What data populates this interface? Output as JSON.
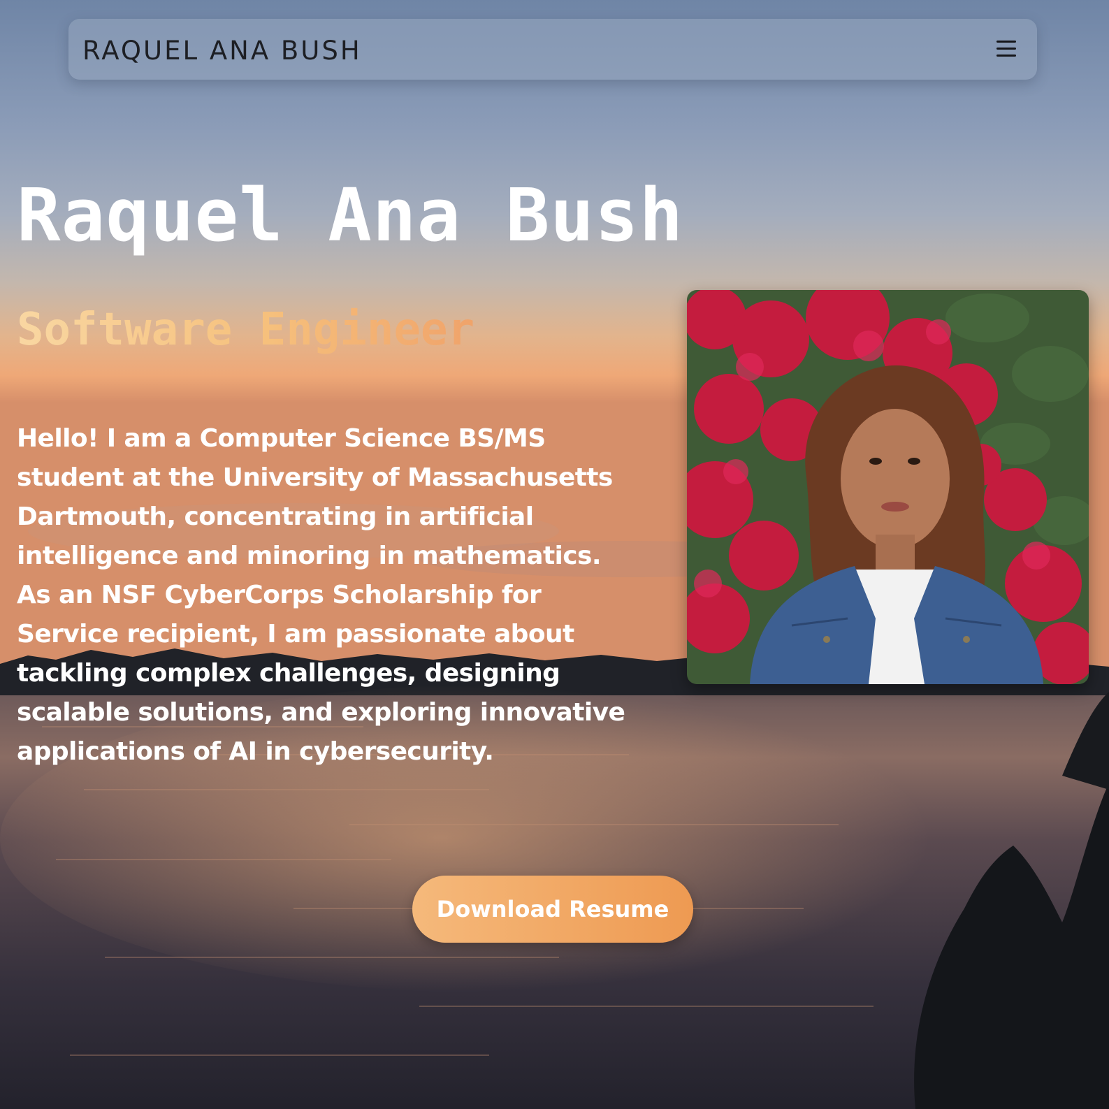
{
  "nav": {
    "brand": "RAQUEL ANA BUSH",
    "menu_icon": "hamburger-menu-icon"
  },
  "hero": {
    "name": "Raquel Ana Bush",
    "role": "Software Engineer",
    "bio": "Hello! I am a Computer Science BS/MS student at the University of Massachusetts Dartmouth, concentrating in artificial intelligence and minoring in mathematics. As an NSF CyberCorps Scholarship for Service recipient, I am passionate about tackling complex challenges, designing scalable solutions, and exploring innovative applications of AI in cybersecurity.",
    "cta_label": "Download Resume"
  },
  "colors": {
    "accent_start": "#f5b97b",
    "accent_end": "#ee9a52",
    "text": "#ffffff",
    "nav_text": "#1d1f24"
  }
}
